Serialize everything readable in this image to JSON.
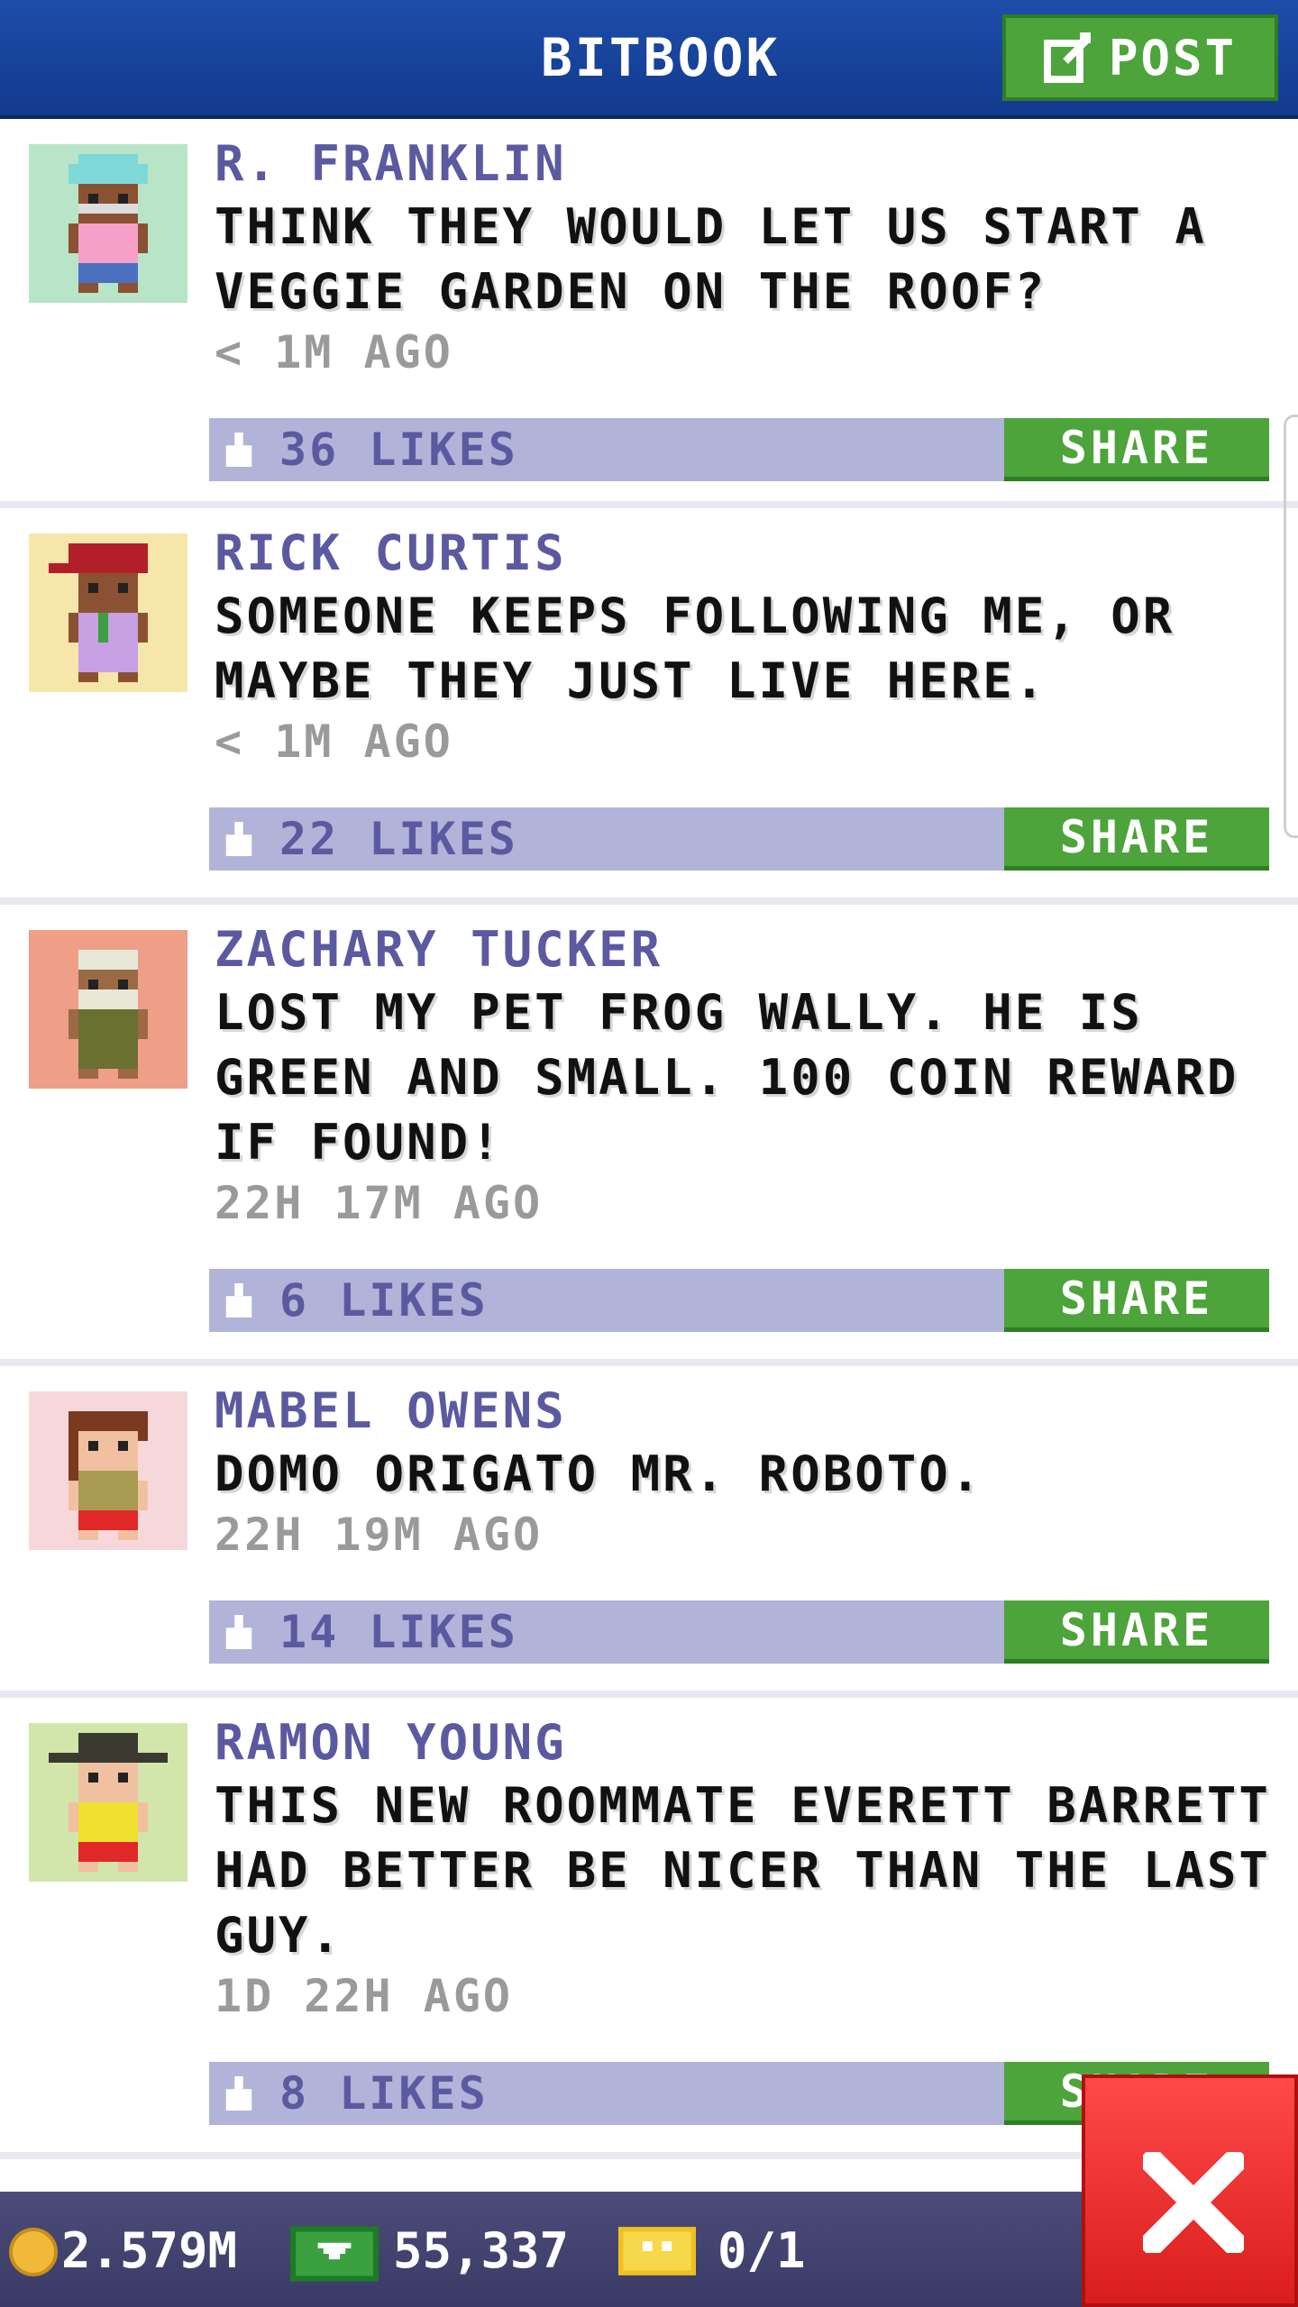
{
  "header": {
    "title": "BITBOOK",
    "post_label": "POST"
  },
  "posts": [
    {
      "name": "R. FRANKLIN",
      "text": "THINK THEY WOULD LET US START A VEGGIE GARDEN ON THE ROOF?",
      "time": "< 1M AGO",
      "likes": "36 LIKES",
      "share": "SHARE",
      "avatar_bg": "#b8e4c8"
    },
    {
      "name": "RICK CURTIS",
      "text": "SOMEONE KEEPS FOLLOWING ME, OR MAYBE THEY JUST LIVE HERE.",
      "time": "< 1M AGO",
      "likes": "22 LIKES",
      "share": "SHARE",
      "avatar_bg": "#f6e6aa"
    },
    {
      "name": "ZACHARY TUCKER",
      "text": "LOST MY PET FROG WALLY. HE IS GREEN AND SMALL. 100 COIN REWARD IF FOUND!",
      "time": "22H 17M AGO",
      "likes": "6 LIKES",
      "share": "SHARE",
      "avatar_bg": "#ef9e88"
    },
    {
      "name": "MABEL OWENS",
      "text": "DOMO ORIGATO MR. ROBOTO.",
      "time": "22H 19M AGO",
      "likes": "14 LIKES",
      "share": "SHARE",
      "avatar_bg": "#f7d8da"
    },
    {
      "name": "RAMON YOUNG",
      "text": "THIS NEW ROOMMATE EVERETT BARRETT HAD BETTER BE NICER THAN THE LAST GUY.",
      "time": "1D 22H AGO",
      "likes": "8 LIKES",
      "share": "SHARE",
      "avatar_bg": "#d2e6ac"
    }
  ],
  "footer": {
    "coins": "2.579M",
    "bux": "55,337",
    "tickets": "0/1"
  },
  "colors": {
    "header_blue": "#1d4da9",
    "share_green": "#4ca43a",
    "like_bar": "#b2b3d8",
    "name_purple": "#5b5aa0",
    "close_red": "#e52b2b"
  }
}
